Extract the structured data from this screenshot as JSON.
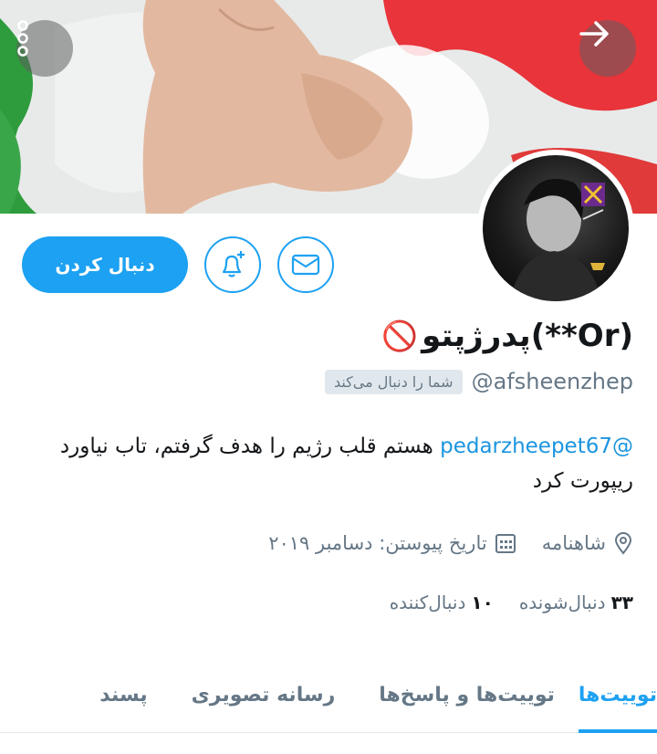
{
  "header": {
    "menu_icon": "more-vertical-icon",
    "back_icon": "arrow-right-icon"
  },
  "profile": {
    "display_name": "پدرژپتو(**Or)",
    "name_emoji": "🚫",
    "handle": "@afsheenzhep",
    "follows_you_badge": "شما را دنبال می‌کند",
    "bio_mention": "@pedarzheepet67",
    "bio_text": " هستم قلب رژیم را هدف گرفتم، تاب نیاورد ریپورت کرد",
    "location": "شاهنامه",
    "joined": "تاریخ پیوستن: دسامبر ۲۰۱۹"
  },
  "actions": {
    "follow_label": "دنبال کردن",
    "bell_icon": "bell-plus-icon",
    "mail_icon": "envelope-icon"
  },
  "stats": {
    "following_count": "۳۳",
    "following_label": "دنبال‌شونده",
    "followers_count": "۱۰",
    "followers_label": "دنبال‌کننده"
  },
  "tabs": [
    {
      "label": "توییت‌ها",
      "active": true
    },
    {
      "label": "توییت‌ها و پاسخ‌ها",
      "active": false
    },
    {
      "label": "رسانه تصویری",
      "active": false
    },
    {
      "label": "پسند",
      "active": false
    }
  ],
  "colors": {
    "accent": "#1da1f2",
    "muted": "#657786",
    "text": "#14171a"
  }
}
